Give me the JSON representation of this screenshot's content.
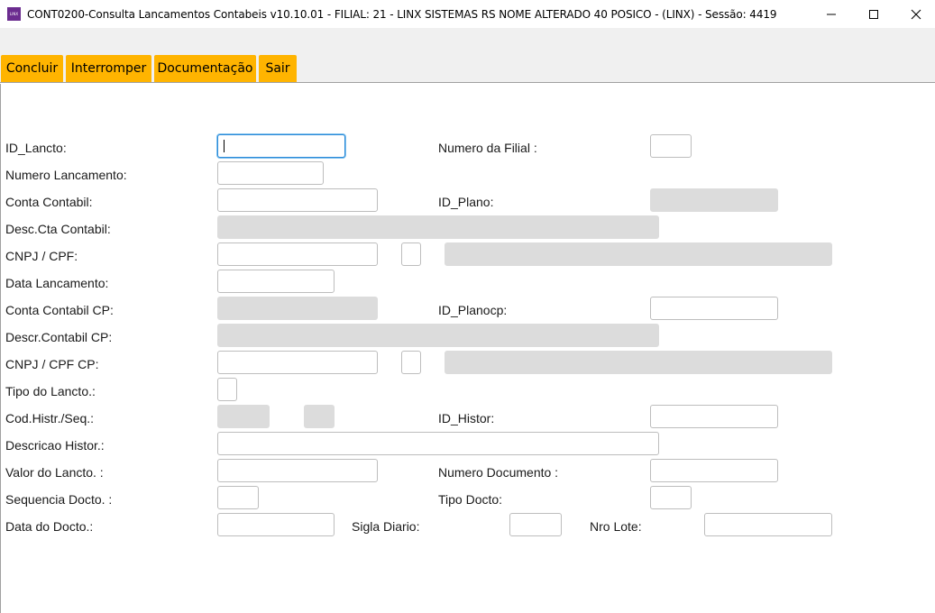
{
  "window": {
    "title": "CONT0200-Consulta Lancamentos Contabeis v10.10.01   - FILIAL: 21 - LINX SISTEMAS RS NOME ALTERADO 40 POSICO - (LINX) - Sessão: 4419",
    "icon_text": "LINX"
  },
  "toolbar": {
    "concluir": "Concluir",
    "interromper": "Interromper",
    "documentacao": "Documentação",
    "sair": "Sair",
    "button_color": "#ffb400"
  },
  "form": {
    "labels": {
      "id_lancto": "ID_Lancto:",
      "numero_filial": "Numero da Filial :",
      "numero_lancamento": "Numero Lancamento:",
      "conta_contabil": "Conta Contabil:",
      "id_plano": "ID_Plano:",
      "desc_cta_contabil": "Desc.Cta Contabil:",
      "cnpj_cpf": "CNPJ / CPF:",
      "data_lancamento": "Data Lancamento:",
      "conta_contabil_cp": "Conta Contabil CP:",
      "id_planocp": "ID_Planocp:",
      "descr_contabil_cp": "Descr.Contabil CP:",
      "cnpj_cpf_cp": "CNPJ / CPF CP:",
      "tipo_lancto": "Tipo do Lancto.:",
      "cod_histr_seq": "Cod.Histr./Seq.:",
      "id_histor": "ID_Histor:",
      "descricao_histor": "Descricao Histor.:",
      "valor_lancto": "Valor do Lancto. :",
      "numero_documento": "Numero Documento :",
      "sequencia_docto": "Sequencia Docto. :",
      "tipo_docto": "Tipo Docto:",
      "data_docto": "Data do Docto.:",
      "sigla_diario": "Sigla Diario:",
      "nro_lote": "Nro Lote:"
    },
    "values": {
      "id_lancto": "",
      "numero_filial": "",
      "numero_lancamento": "",
      "conta_contabil": "",
      "id_plano": "",
      "desc_cta_contabil": "",
      "cnpj_cpf": "",
      "cnpj_cpf_digit": "",
      "cnpj_cpf_name": "",
      "data_lancamento": "",
      "conta_contabil_cp": "",
      "id_planocp": "",
      "descr_contabil_cp": "",
      "cnpj_cpf_cp": "",
      "cnpj_cpf_cp_digit": "",
      "cnpj_cpf_cp_name": "",
      "tipo_lancto": "",
      "cod_histr": "",
      "seq": "",
      "id_histor": "",
      "descricao_histor": "",
      "valor_lancto": "",
      "numero_documento": "",
      "sequencia_docto": "",
      "tipo_docto": "",
      "data_docto": "",
      "sigla_diario": "",
      "nro_lote": ""
    }
  }
}
